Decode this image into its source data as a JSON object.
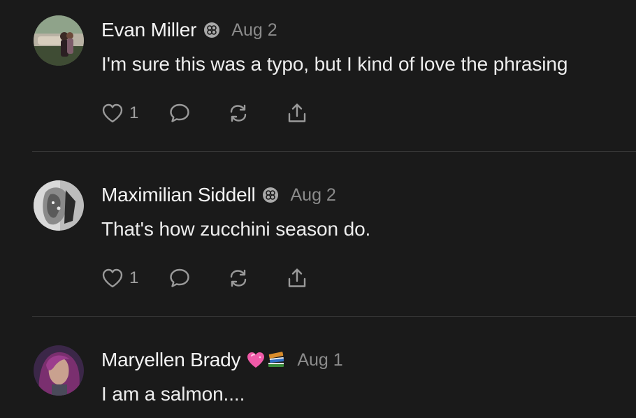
{
  "comments": [
    {
      "author": "Evan Miller",
      "badge": "subscriber-badge-icon",
      "date": "Aug 2",
      "text": "I'm sure this was a typo, but I kind of love the phrasing",
      "likes": "1"
    },
    {
      "author": "Maximilian Siddell",
      "badge": "subscriber-badge-icon",
      "date": "Aug 2",
      "text": "That's how zucchini season do.",
      "likes": "1"
    },
    {
      "author": "Maryellen Brady",
      "badge_emoji": "💗📚",
      "date": "Aug 1",
      "text": "I am a salmon...."
    }
  ],
  "colors": {
    "background": "#1a1a1a",
    "text": "#f2f2f2",
    "muted": "#8b8b8b",
    "divider": "#3a3a3a"
  }
}
